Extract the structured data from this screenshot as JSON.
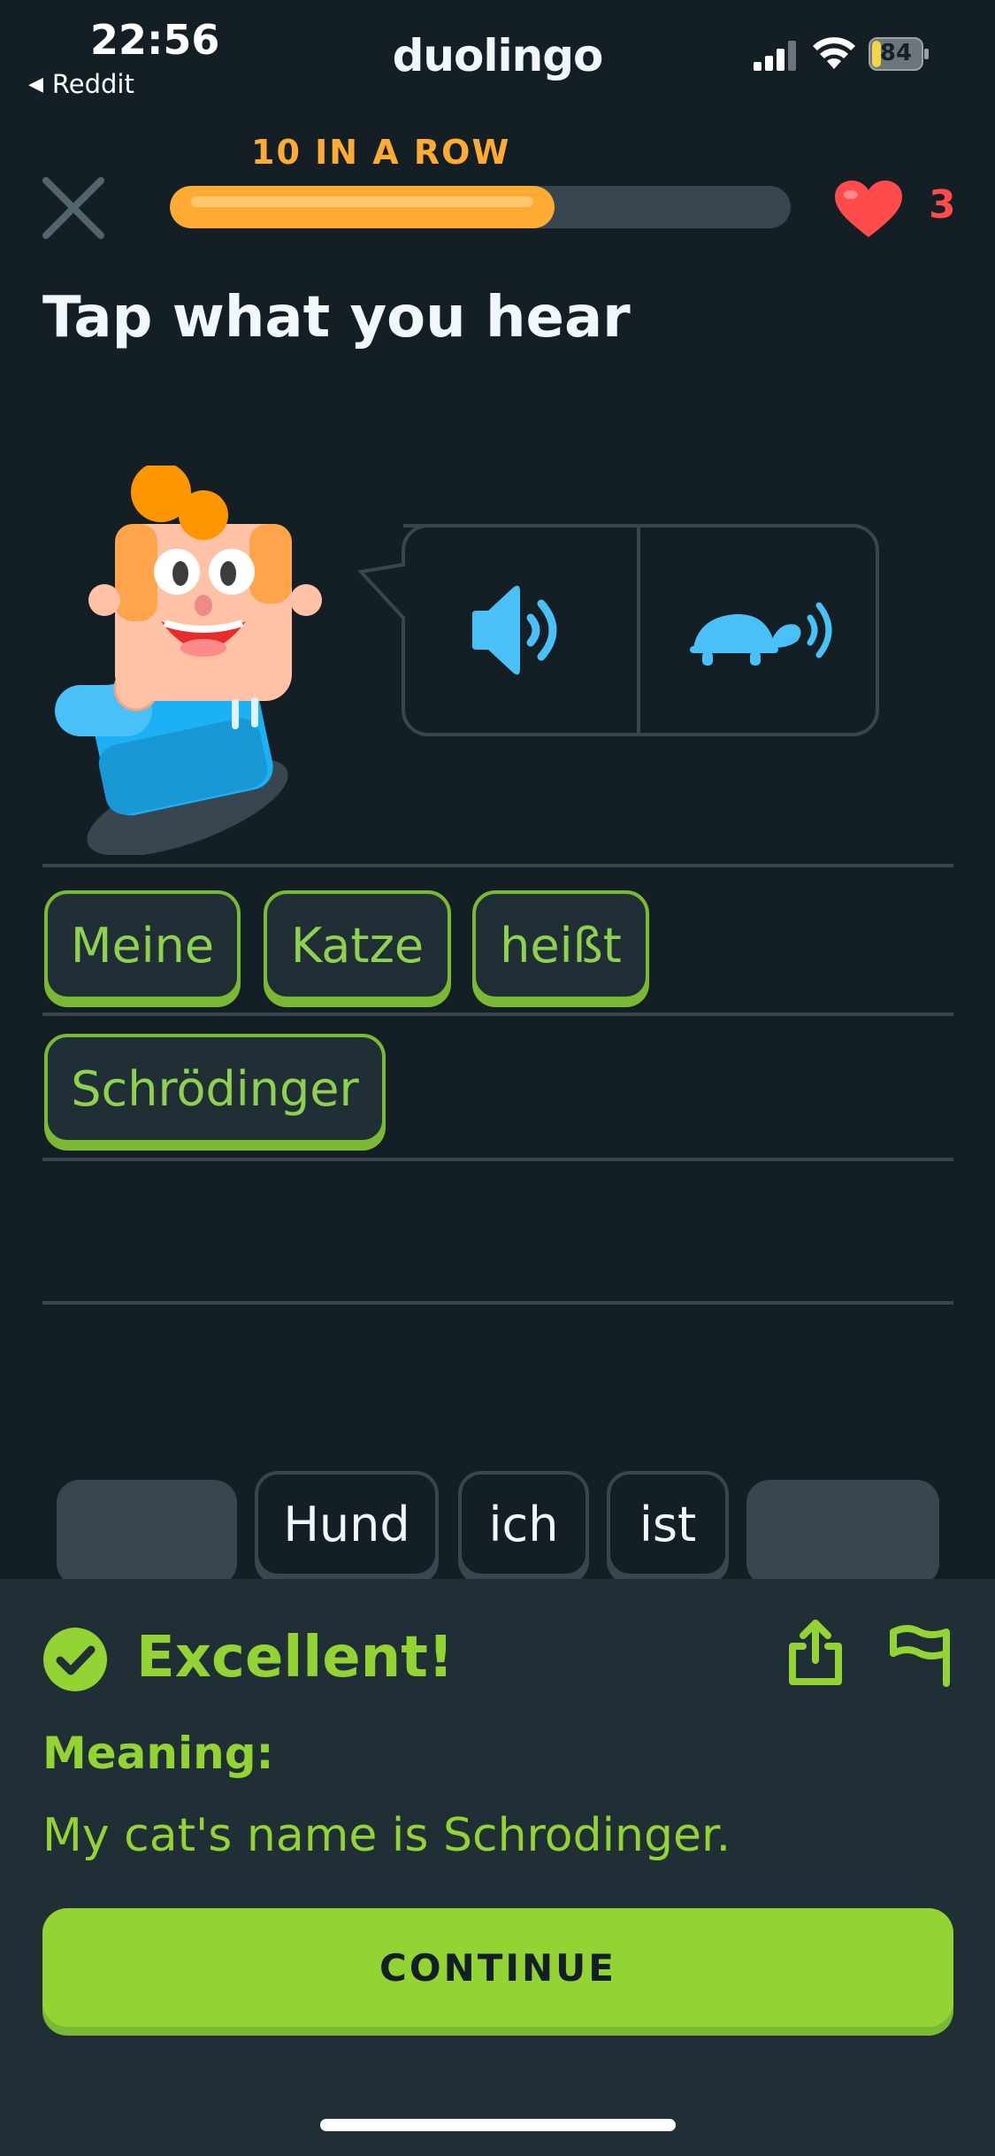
{
  "status_bar": {
    "time": "22:56",
    "back_app": "Reddit",
    "back_icon": "back-triangle-icon",
    "battery_level": "84"
  },
  "app": {
    "title": "duolingo"
  },
  "header": {
    "streak_text": "10 IN A ROW",
    "progress_fraction": 0.62,
    "hearts": "3",
    "colors": {
      "progress": "#ffab33",
      "track": "#37464f",
      "heart": "#ff4b4b"
    }
  },
  "exercise": {
    "prompt": "Tap what you hear",
    "audio_buttons": [
      {
        "icon": "speaker-icon"
      },
      {
        "icon": "turtle-slow-icon"
      }
    ],
    "answer_words": [
      "Meine",
      "Katze",
      "heißt",
      "Schrödinger"
    ],
    "word_bank": [
      "Hund",
      "ich",
      "ist"
    ]
  },
  "feedback": {
    "title": "Excellent!",
    "meaning_label": "Meaning:",
    "meaning_text": "My cat's name is Schrodinger.",
    "continue_label": "CONTINUE",
    "colors": {
      "accent": "#93d333",
      "accent_shadow": "#79b933",
      "panel": "#202f36"
    }
  }
}
